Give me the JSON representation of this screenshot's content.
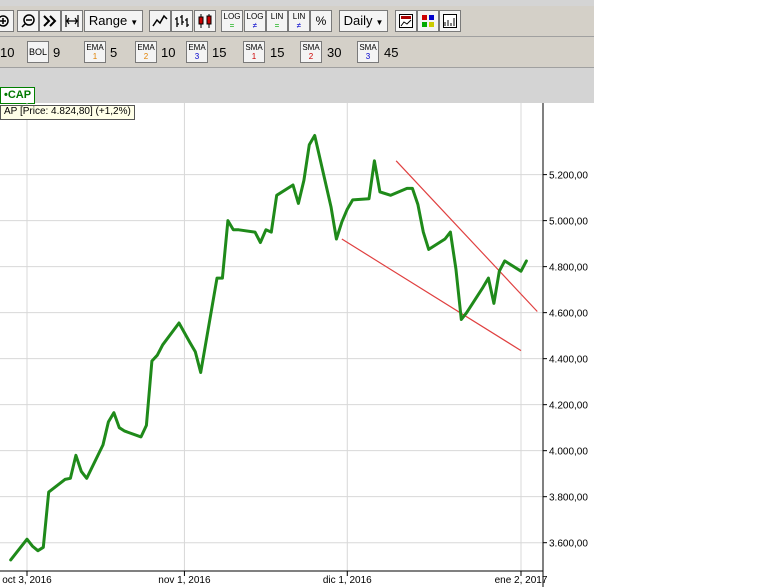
{
  "toolbar1": {
    "range_label": "Range",
    "period_label": "Daily",
    "log_eq": "LOG",
    "log_ne": "LOG",
    "lin_eq": "LIN",
    "lin_ne": "LIN",
    "percent": "%",
    "eq": "=",
    "ne": "≠"
  },
  "toolbar2": {
    "first_value": "10",
    "bol_label": "BOL",
    "bol_value": "9",
    "ema_label": "EMA",
    "ema": [
      {
        "n": "1",
        "value": "5"
      },
      {
        "n": "2",
        "value": "10"
      },
      {
        "n": "3",
        "value": "15"
      }
    ],
    "sma_label": "SMA",
    "sma": [
      {
        "n": "1",
        "value": "15"
      },
      {
        "n": "2",
        "value": "30"
      },
      {
        "n": "3",
        "value": "45"
      }
    ]
  },
  "colors": {
    "price_line": "#1f8a1a",
    "trend_line": "#e04040",
    "grid": "#d8d8d8",
    "ema_sub": "#e08000",
    "sma_sub": "#cc0000",
    "ema3_sub": "#0000cc"
  },
  "legend": {
    "symbol": "•CAP",
    "info": "AP [Price: 4.824,80] (+1,2%)"
  },
  "chart_data": {
    "type": "line",
    "x_ticks": [
      "oct 3, 2016",
      "nov 1, 2016",
      "dic 1, 2016",
      "ene 2, 2017"
    ],
    "y_ticks": [
      3600,
      3800,
      4000,
      4200,
      4400,
      4600,
      4800,
      5000,
      5200
    ],
    "y_tick_labels": [
      "3.600,00",
      "3.800,00",
      "4.000,00",
      "4.200,00",
      "4.400,00",
      "4.600,00",
      "4.800,00",
      "5.000,00",
      "5.200,00"
    ],
    "ylim": [
      3490,
      5420
    ],
    "x": [
      "2016-09-30",
      "2016-10-03",
      "2016-10-04",
      "2016-10-05",
      "2016-10-06",
      "2016-10-07",
      "2016-10-10",
      "2016-10-11",
      "2016-10-12",
      "2016-10-13",
      "2016-10-14",
      "2016-10-17",
      "2016-10-18",
      "2016-10-19",
      "2016-10-20",
      "2016-10-21",
      "2016-10-24",
      "2016-10-25",
      "2016-10-26",
      "2016-10-27",
      "2016-10-28",
      "2016-10-31",
      "2016-11-02",
      "2016-11-03",
      "2016-11-04",
      "2016-11-07",
      "2016-11-08",
      "2016-11-09",
      "2016-11-10",
      "2016-11-11",
      "2016-11-14",
      "2016-11-15",
      "2016-11-16",
      "2016-11-17",
      "2016-11-18",
      "2016-11-21",
      "2016-11-22",
      "2016-11-23",
      "2016-11-24",
      "2016-11-25",
      "2016-11-28",
      "2016-11-29",
      "2016-11-30",
      "2016-12-01",
      "2016-12-02",
      "2016-12-05",
      "2016-12-06",
      "2016-12-07",
      "2016-12-09",
      "2016-12-12",
      "2016-12-13",
      "2016-12-14",
      "2016-12-15",
      "2016-12-16",
      "2016-12-19",
      "2016-12-20",
      "2016-12-21",
      "2016-12-22",
      "2016-12-23",
      "2016-12-26",
      "2016-12-27",
      "2016-12-28",
      "2016-12-29",
      "2016-12-30",
      "2017-01-02",
      "2017-01-03"
    ],
    "values": [
      3525,
      3615,
      3585,
      3565,
      3580,
      3820,
      3875,
      3880,
      3980,
      3910,
      3880,
      4025,
      4125,
      4165,
      4100,
      4085,
      4060,
      4110,
      4390,
      4415,
      4460,
      4555,
      4470,
      4430,
      4340,
      4750,
      4750,
      5000,
      4960,
      4960,
      4950,
      4905,
      4960,
      4950,
      5110,
      5155,
      5075,
      5175,
      5330,
      5370,
      5060,
      4920,
      4995,
      5050,
      5090,
      5095,
      5260,
      5125,
      5110,
      5140,
      5140,
      5070,
      4950,
      4875,
      4920,
      4950,
      4790,
      4570,
      4600,
      4710,
      4750,
      4640,
      4780,
      4825,
      4780,
      4825
    ],
    "trendlines": [
      {
        "from": [
          "2016-12-10",
          5260
        ],
        "to": [
          "2017-01-05",
          4605
        ]
      },
      {
        "from": [
          "2016-11-30",
          4920
        ],
        "to": [
          "2017-01-02",
          4435
        ]
      }
    ],
    "grid": true,
    "ylabel_position": "right"
  }
}
